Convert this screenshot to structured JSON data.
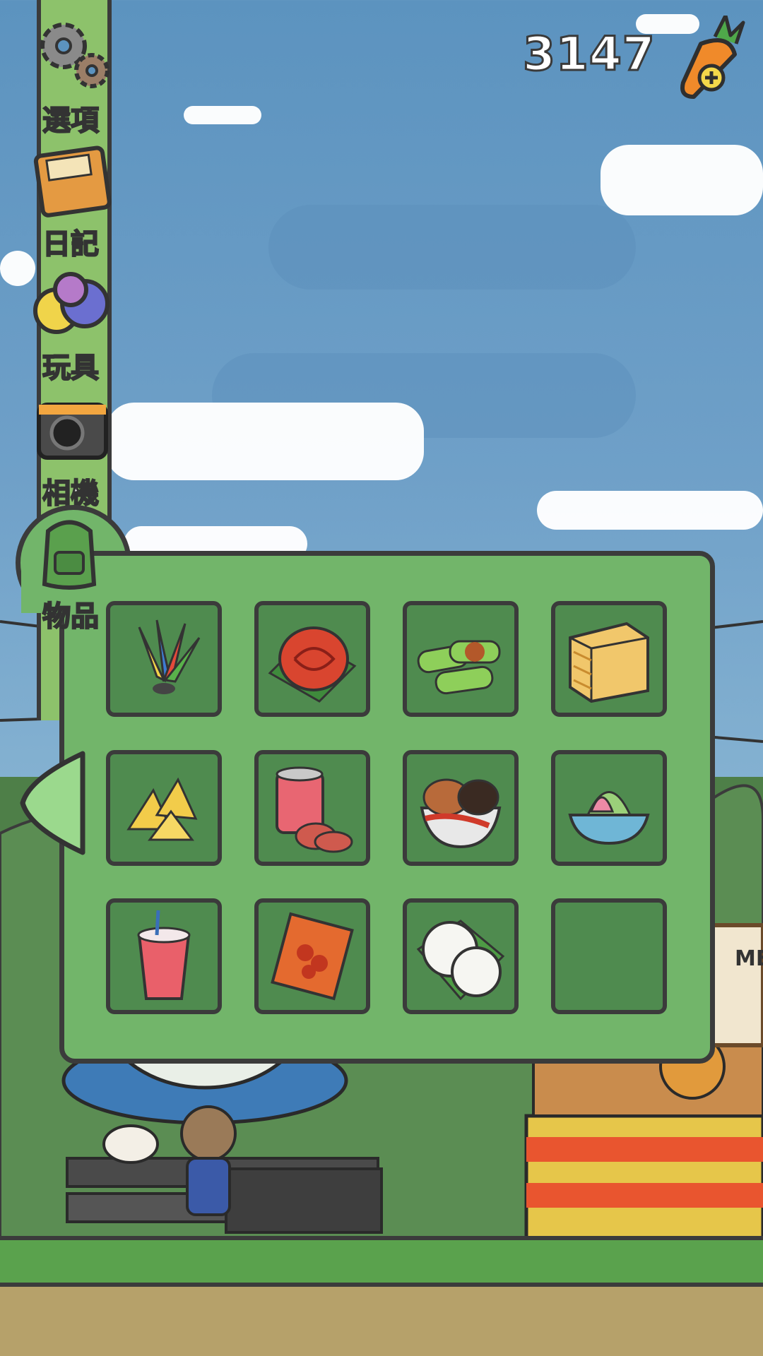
{
  "hud": {
    "currency_amount": "3147",
    "currency_icon": "carrot-plus-icon"
  },
  "sidebar": {
    "items": [
      {
        "label": "選項",
        "icon": "gear-icon"
      },
      {
        "label": "日記",
        "icon": "diary-icon"
      },
      {
        "label": "玩具",
        "icon": "toy-balls-icon"
      },
      {
        "label": "相機",
        "icon": "camera-icon"
      },
      {
        "label": "物品",
        "icon": "backpack-icon",
        "selected": true
      }
    ]
  },
  "inventory": {
    "slots": [
      {
        "icon": "feather-shuttlecock-icon"
      },
      {
        "icon": "red-tortoise-cake-icon"
      },
      {
        "icon": "spring-roll-icon"
      },
      {
        "icon": "layer-cake-icon"
      },
      {
        "icon": "samosa-icon"
      },
      {
        "icon": "canned-luncheon-meat-icon"
      },
      {
        "icon": "rice-bowl-icon"
      },
      {
        "icon": "shaved-ice-dessert-icon"
      },
      {
        "icon": "pink-drink-icon"
      },
      {
        "icon": "dried-chili-packet-icon"
      },
      {
        "icon": "steamed-bun-icon"
      },
      {
        "icon": "empty"
      }
    ]
  },
  "scene": {
    "sign_text": "ME"
  },
  "colors": {
    "panel_green": "#72b56a",
    "slot_green": "#4f8b4f",
    "outline": "#3b3b3b",
    "sky": "#6fa0c8"
  }
}
